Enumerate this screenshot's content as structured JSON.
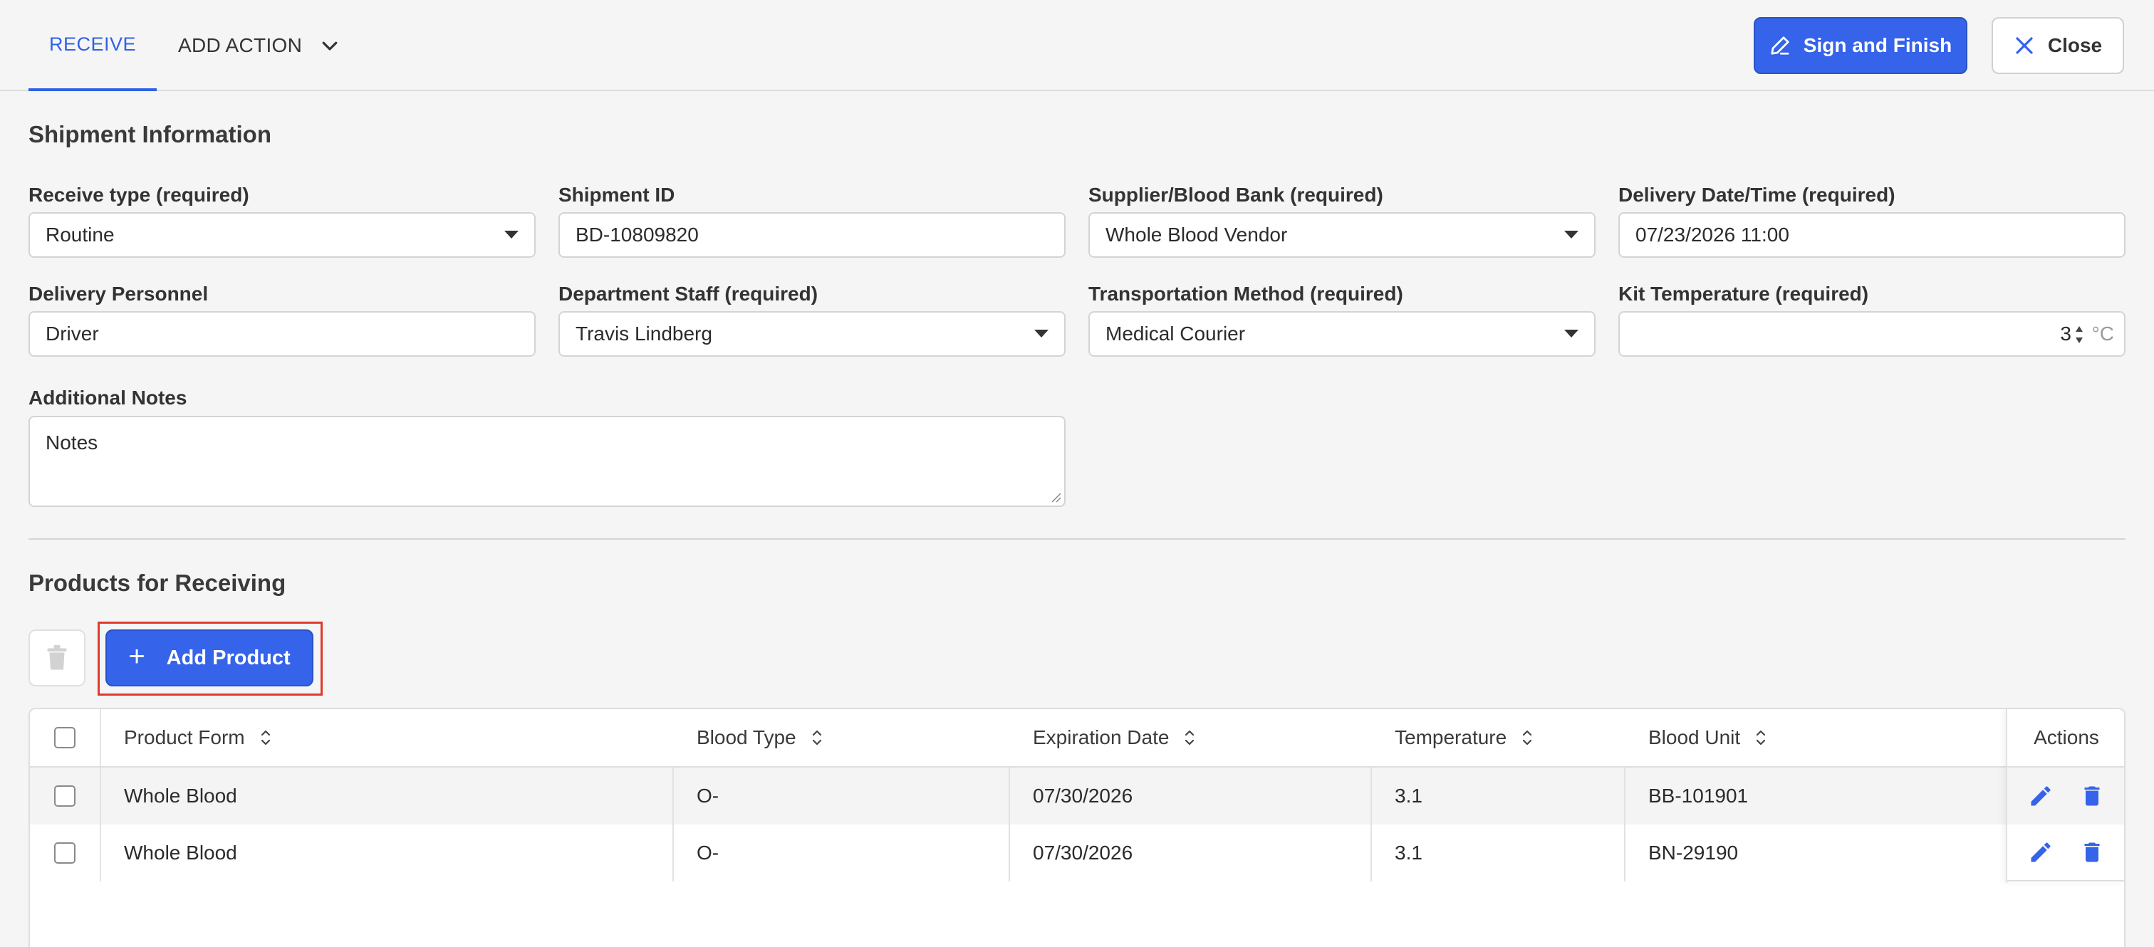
{
  "header": {
    "tab_receive": "RECEIVE",
    "tab_add_action": "ADD ACTION",
    "sign_button": "Sign and Finish",
    "close_button": "Close"
  },
  "shipment": {
    "section_title": "Shipment Information",
    "receive_type": {
      "label": "Receive type (required)",
      "value": "Routine"
    },
    "shipment_id": {
      "label": "Shipment ID",
      "value": "BD-10809820"
    },
    "supplier": {
      "label": "Supplier/Blood Bank (required)",
      "value": "Whole Blood Vendor"
    },
    "delivery_datetime": {
      "label": "Delivery Date/Time (required)",
      "value": "07/23/2026 11:00"
    },
    "delivery_personnel": {
      "label": "Delivery Personnel",
      "value": "Driver"
    },
    "department_staff": {
      "label": "Department Staff (required)",
      "value": "Travis Lindberg"
    },
    "transport_method": {
      "label": "Transportation Method (required)",
      "value": "Medical Courier"
    },
    "kit_temperature": {
      "label": "Kit Temperature (required)",
      "value": "3",
      "unit": "°C"
    },
    "notes": {
      "label": "Additional Notes",
      "value": "Notes"
    }
  },
  "products": {
    "section_title": "Products for Receiving",
    "add_button": "Add Product",
    "columns": {
      "form": "Product Form",
      "blood_type": "Blood Type",
      "expiration": "Expiration Date",
      "temperature": "Temperature",
      "unit": "Blood Unit",
      "actions": "Actions"
    },
    "rows": [
      {
        "form": "Whole Blood",
        "blood_type": "O-",
        "expiration": "07/30/2026",
        "temperature": "3.1",
        "unit": "BB-101901"
      },
      {
        "form": "Whole Blood",
        "blood_type": "O-",
        "expiration": "07/30/2026",
        "temperature": "3.1",
        "unit": "BN-29190"
      }
    ]
  },
  "colors": {
    "accent": "#3563e9",
    "highlight_border": "#e03a2c",
    "background": "#f5f5f5"
  }
}
